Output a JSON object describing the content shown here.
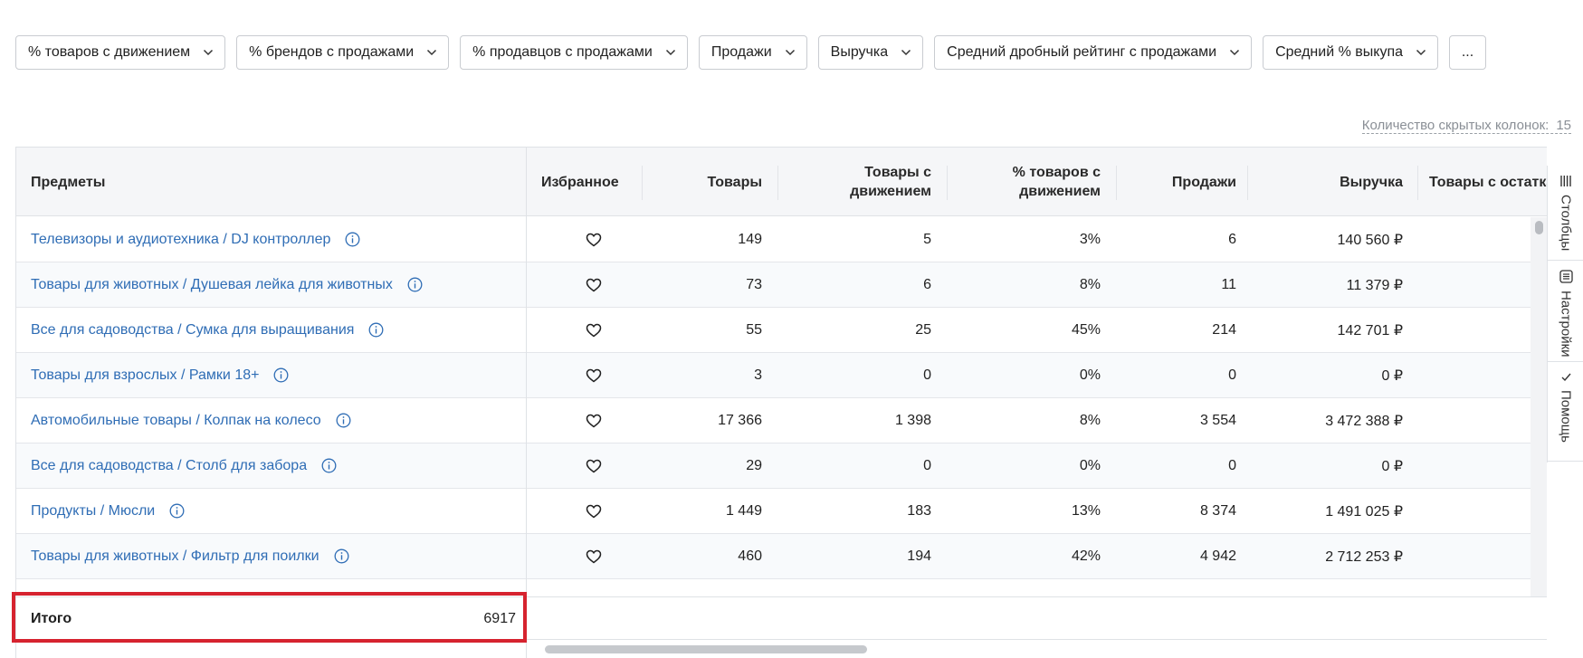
{
  "filters": [
    "% товаров с движением",
    "% брендов с продажами",
    "% продавцов с продажами",
    "Продажи",
    "Выручка",
    "Средний дробный рейтинг с продажами",
    "Средний % выкупа"
  ],
  "more_label": "...",
  "hidden_columns": {
    "label": "Количество скрытых колонок:",
    "count": "15"
  },
  "columns": {
    "subject": "Предметы",
    "favorite": "Избранное",
    "products": "Товары",
    "moving": "Товары с движением",
    "moving_pct": "% товаров с движением",
    "sales": "Продажи",
    "revenue": "Выручка",
    "stock": "Товары с остатка"
  },
  "rows": [
    {
      "subject": "Телевизоры и аудиотехника / DJ контроллер",
      "products": "149",
      "moving": "5",
      "moving_pct": "3%",
      "sales": "6",
      "revenue": "140 560 ₽"
    },
    {
      "subject": "Товары для животных / Душевая лейка для животных",
      "products": "73",
      "moving": "6",
      "moving_pct": "8%",
      "sales": "11",
      "revenue": "11 379 ₽"
    },
    {
      "subject": "Все для садоводства / Сумка для выращивания",
      "products": "55",
      "moving": "25",
      "moving_pct": "45%",
      "sales": "214",
      "revenue": "142 701 ₽"
    },
    {
      "subject": "Товары для взрослых / Рамки 18+",
      "products": "3",
      "moving": "0",
      "moving_pct": "0%",
      "sales": "0",
      "revenue": "0 ₽"
    },
    {
      "subject": "Автомобильные товары / Колпак на колесо",
      "products": "17 366",
      "moving": "1 398",
      "moving_pct": "8%",
      "sales": "3 554",
      "revenue": "3 472 388 ₽"
    },
    {
      "subject": "Все для садоводства / Столб для забора",
      "products": "29",
      "moving": "0",
      "moving_pct": "0%",
      "sales": "0",
      "revenue": "0 ₽"
    },
    {
      "subject": "Продукты / Мюсли",
      "products": "1 449",
      "moving": "183",
      "moving_pct": "13%",
      "sales": "8 374",
      "revenue": "1 491 025 ₽"
    },
    {
      "subject": "Товары для животных / Фильтр для поилки",
      "products": "460",
      "moving": "194",
      "moving_pct": "42%",
      "sales": "4 942",
      "revenue": "2 712 253 ₽"
    }
  ],
  "total": {
    "label": "Итого",
    "value": "6917"
  },
  "side_panel": {
    "columns": "Столбцы",
    "settings": "Настройки",
    "help": "Помощь"
  }
}
